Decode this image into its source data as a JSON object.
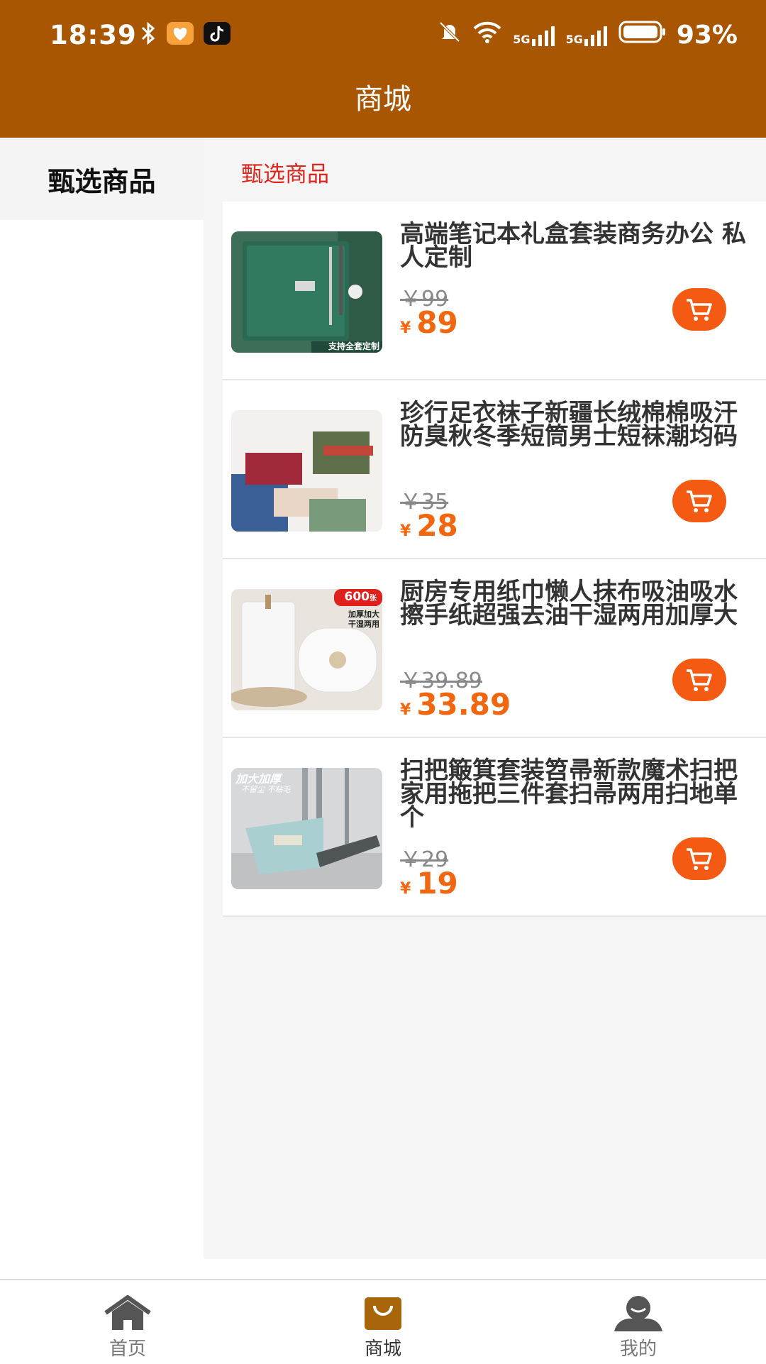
{
  "status_bar": {
    "time": "18:39",
    "battery": "93%",
    "signal_label_1": "5G",
    "signal_label_2": "5G",
    "icons": [
      "bluetooth-icon",
      "heart-app-icon",
      "tiktok-app-icon",
      "mute-icon",
      "wifi-icon",
      "signal-icon",
      "signal-icon",
      "battery-icon"
    ]
  },
  "header": {
    "title": "商城"
  },
  "sidebar": {
    "items": [
      {
        "label": "甄选商品",
        "selected": true
      }
    ]
  },
  "main": {
    "section_title": "甄选商品",
    "products": [
      {
        "title": "高端笔记本礼盒套装商务办公 私人定制",
        "old_price": "￥99",
        "currency": "¥",
        "price": "89",
        "image": "green-notebook-gift-box",
        "image_text": "支持全套定制"
      },
      {
        "title": "珍行足衣袜子新疆长绒棉棉吸汗防臭秋冬季短筒男士短袜潮均码",
        "old_price": "￥35",
        "currency": "¥",
        "price": "28",
        "image": "socks"
      },
      {
        "title": "厨房专用纸巾懒人抹布吸油吸水擦手纸超强去油干湿两用加厚大",
        "old_price": "￥39.89",
        "currency": "¥",
        "price": "33.89",
        "image": "kitchen-paper-towel-rolls",
        "image_badge": "600",
        "image_badge_unit": "张",
        "image_tag_1": "加厚加大",
        "image_tag_2": "干湿两用"
      },
      {
        "title": "扫把簸箕套装笤帚新款魔术扫把家用拖把三件套扫帚两用扫地单个",
        "old_price": "￥29",
        "currency": "¥",
        "price": "19",
        "image": "broom-dustpan-set",
        "image_tag_1": "加大加厚",
        "image_tag_2": "不留尘 不粘毛"
      }
    ]
  },
  "bottom_nav": {
    "tabs": [
      {
        "label": "首页",
        "icon": "home-icon",
        "active": false
      },
      {
        "label": "商城",
        "icon": "shopping-bag-icon",
        "active": true
      },
      {
        "label": "我的",
        "icon": "user-icon",
        "active": false
      }
    ]
  },
  "colors": {
    "header_bg": "#a85602",
    "price": "#f2660f",
    "cart_button": "#f45a12",
    "section_title": "#e0241b",
    "active_tab_icon": "#a8650a"
  }
}
